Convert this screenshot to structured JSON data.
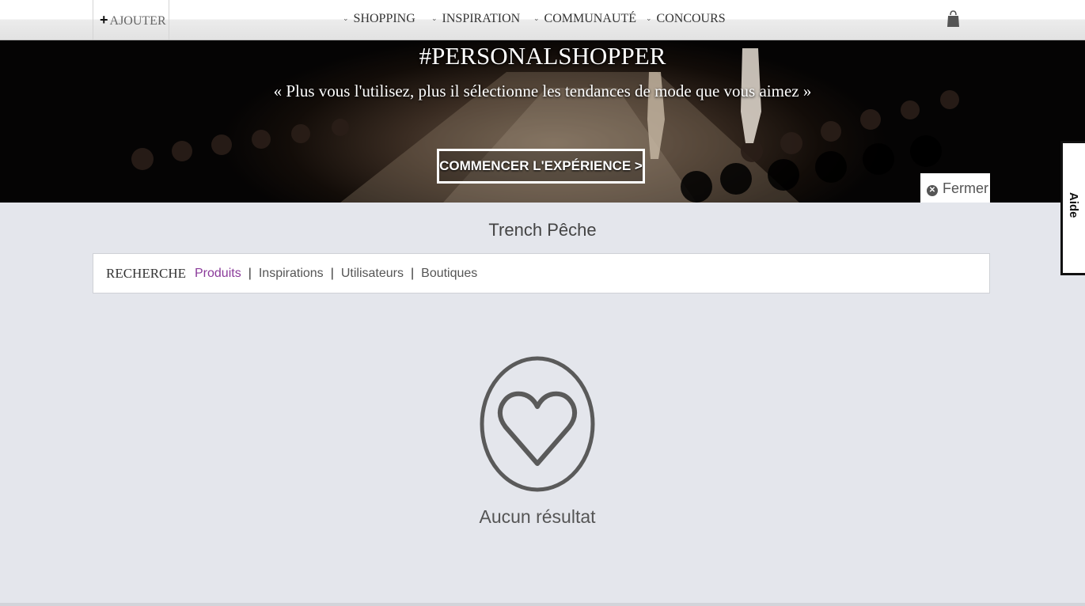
{
  "topbar": {
    "add_label": "AJOUTER",
    "nav": [
      "SHOPPING",
      "INSPIRATION",
      "COMMUNAUTÉ",
      "CONCOURS"
    ],
    "icons": {
      "add": "plus-icon",
      "chevron": "chevron-down-icon",
      "cart": "shopping-bag-icon"
    }
  },
  "banner": {
    "title": "#PERSONALSHOPPER",
    "subtitle": "« Plus vous l'utilisez, plus il sélectionne les tendances de mode que vous aimez »",
    "cta": "COMMENCER L'EXPÉRIENCE >",
    "close": "Fermer"
  },
  "help_tab": {
    "label": "Aide"
  },
  "search": {
    "query": "Trench Pêche",
    "label": "RECHERCHE",
    "filters": [
      "Produits",
      "Inspirations",
      "Utilisateurs",
      "Boutiques"
    ],
    "active_filter": "Produits"
  },
  "results": {
    "empty_text": "Aucun résultat",
    "empty_icon": "heart-icon"
  },
  "colors": {
    "background": "#e4e6ec",
    "accent": "#8a3a9a",
    "text": "#444444"
  }
}
